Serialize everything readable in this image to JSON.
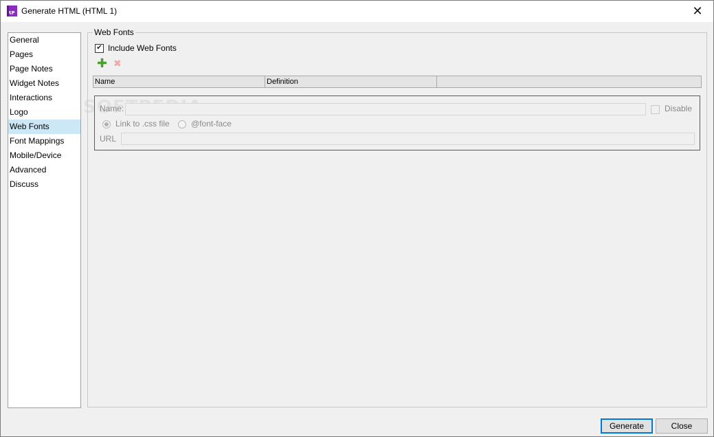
{
  "window": {
    "title": "Generate HTML (HTML 1)",
    "app_icon_text": "RP",
    "close_glyph": "✕"
  },
  "sidebar": {
    "items": [
      {
        "label": "General"
      },
      {
        "label": "Pages"
      },
      {
        "label": "Page Notes"
      },
      {
        "label": "Widget Notes"
      },
      {
        "label": "Interactions"
      },
      {
        "label": "Logo"
      },
      {
        "label": "Web Fonts",
        "selected": true
      },
      {
        "label": "Font Mappings"
      },
      {
        "label": "Mobile/Device"
      },
      {
        "label": "Advanced"
      },
      {
        "label": "Discuss"
      }
    ]
  },
  "web_fonts": {
    "group_title": "Web Fonts",
    "include_label": "Include Web Fonts",
    "include_checked": true,
    "checkmark": "✔",
    "add_icon": "plus-icon",
    "remove_icon": "x-icon",
    "add_glyph": "✚",
    "remove_glyph": "✖",
    "table": {
      "columns": [
        "Name",
        "Definition",
        ""
      ]
    },
    "detail": {
      "name_label": "Name:",
      "name_value": "",
      "disable_label": "Disable",
      "link_css_label": "Link to .css file",
      "font_face_label": "@font-face",
      "url_label": "URL",
      "url_value": ""
    }
  },
  "watermark": "SOFTPEDIA",
  "buttons": {
    "generate": "Generate",
    "close": "Close"
  },
  "colors": {
    "selected_item_bg": "#cce8f6",
    "add_icon": "#4aa02c",
    "remove_icon_disabled": "#f0a8a8",
    "primary_border": "#0078d7"
  }
}
